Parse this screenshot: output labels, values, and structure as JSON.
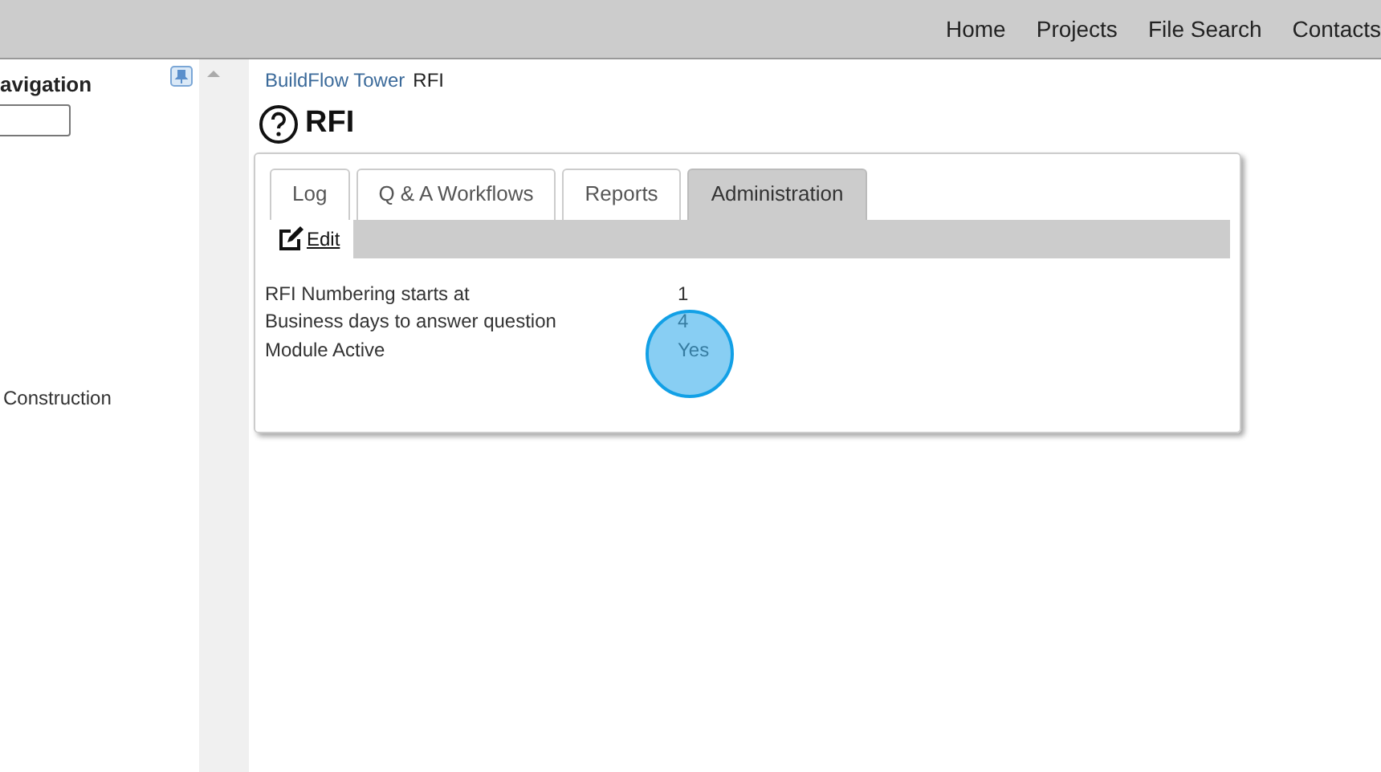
{
  "top_nav": [
    {
      "label": "Home"
    },
    {
      "label": "Projects"
    },
    {
      "label": "File Search"
    },
    {
      "label": "Contacts"
    }
  ],
  "sidebar": {
    "title": "avigation",
    "items": [
      {
        "label": "Construction"
      }
    ]
  },
  "breadcrumb": [
    {
      "label": "BuildFlow Tower",
      "kind": "link"
    },
    {
      "label": "RFI",
      "kind": "current"
    }
  ],
  "page_title": "RFI",
  "tabs": [
    {
      "label": "Log",
      "selected": false
    },
    {
      "label": "Q & A Workflows",
      "selected": false
    },
    {
      "label": "Reports",
      "selected": false
    },
    {
      "label": "Administration",
      "selected": true
    }
  ],
  "toolbar": {
    "edit": "Edit"
  },
  "settings": [
    {
      "label": "RFI Numbering starts at",
      "value": "1"
    },
    {
      "label": "Business days to answer question",
      "value": "4"
    },
    {
      "label": "Module Active",
      "value": "Yes"
    }
  ]
}
